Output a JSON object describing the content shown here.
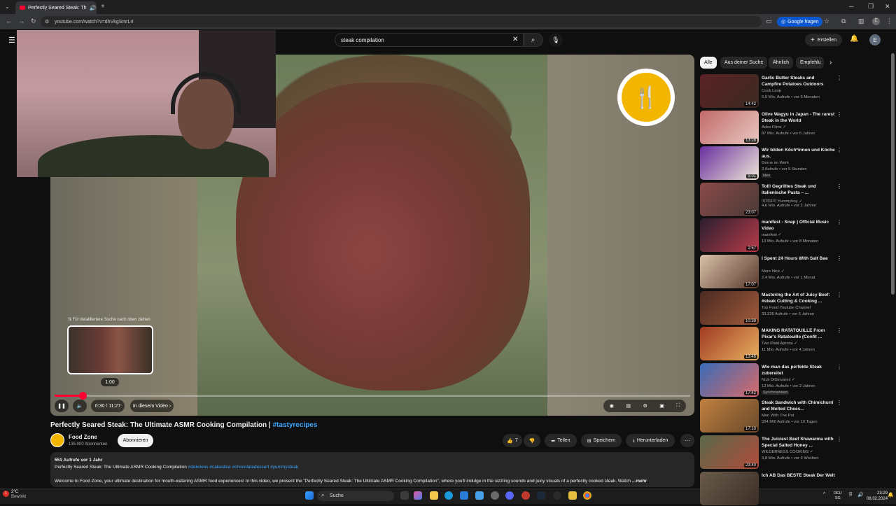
{
  "browser": {
    "tab_title": "Perfectly Seared Steak: Th",
    "url": "youtube.com/watch?v=dhVkgSmrLrI",
    "google_button": "Google fragen",
    "profile_initial": "E"
  },
  "header": {
    "search_value": "steak compilation",
    "create_label": "Erstellen",
    "avatar_initial": "E"
  },
  "player": {
    "hint_text": "⇅ Für detailliertere Suche nach oben ziehen",
    "preview_time": "1:00",
    "time": "0:30 / 11:27",
    "chapter_label": "In diesem Video",
    "progress_fraction": 0.044
  },
  "video": {
    "title": "Perfectly Seared Steak: The Ultimate ASMR Cooking Compilation | ",
    "title_tag": "#tastyrecipes",
    "channel_name": "Food Zone",
    "subscribers": "135.000 Abonnenten",
    "subscribe_label": "Abonnieren",
    "likes": "7",
    "share_label": "Teilen",
    "save_label": "Speichern",
    "download_label": "Herunterladen",
    "views_date": "551 Aufrufe  vor 1 Jahr",
    "desc_line1": "Perfectly Seared Steak: The Ultimate ASMR Cooking Compilation ",
    "desc_tags": "#delicious #cakeslice #chocolatedessert #yummysteak",
    "desc_line2": "Welcome to Food Zone, your ultimate destination for mouth-watering ASMR food experiences! In this video, we present the \"Perfectly Seared Steak: The Ultimate ASMR Cooking Compilation\", where you'll indulge in the sizzling sounds and juicy visuals of a perfectly cooked steak. Watch",
    "desc_more": "...mehr"
  },
  "sidebar": {
    "chips": [
      "Alle",
      "Aus deiner Suche",
      "Ähnlich",
      "Empfehlu"
    ],
    "recs": [
      {
        "title": "Garlic Butter Steaks and Campfire Potatoes Outdoors",
        "channel": "Cook Loop",
        "meta": "5,5 Mio. Aufrufe • vor 5 Monaten",
        "duration": "14:42",
        "colors": [
          "#5b2226",
          "#3c2a22"
        ]
      },
      {
        "title": "Olive Wagyu in Japan - The rarest Steak in the World",
        "channel": "Ades Films ✓",
        "meta": "87 Mio. Aufrufe • vor 6 Jahren",
        "duration": "13:28",
        "colors": [
          "#c26a6a",
          "#e8c8c0"
        ]
      },
      {
        "title": "Wir bilden Köch*innen und Köche aus.",
        "channel": "Gerne im Werk",
        "meta": "3 Aufrufe • vor 5 Stunden",
        "badge": "Neu",
        "duration": "9:01",
        "colors": [
          "#6a2fa0",
          "#efe6d8"
        ]
      },
      {
        "title": "Toll! Gegrilltes Steak und italienische Pasta – ...",
        "channel": "야미보이 Yummyboy ✓",
        "meta": "4,6 Mio. Aufrufe • vor 2 Jahren",
        "duration": "23:07",
        "colors": [
          "#8a4a4a",
          "#4a3a36"
        ]
      },
      {
        "title": "manifest - Snap | Official Music Video",
        "channel": "manifest ✓",
        "meta": "13 Mio. Aufrufe • vor 8 Monaten",
        "duration": "2:57",
        "colors": [
          "#2a1f2e",
          "#b83a4a"
        ]
      },
      {
        "title": "I Spent 24 Hours With Salt Bae",
        "channel": "More Nick ✓",
        "meta": "2,4 Mio. Aufrufe • vor 1 Monat",
        "duration": "17:07",
        "colors": [
          "#d8c0a8",
          "#5a3a2e"
        ]
      },
      {
        "title": "Mastering the Art of Juicy Beef: #steak  Cutting & Cooking ...",
        "channel": "Top Food Youtube Channel",
        "meta": "33.326 Aufrufe • vor 5 Jahren",
        "duration": "10:39",
        "colors": [
          "#4a2a22",
          "#a05a3a"
        ]
      },
      {
        "title": "MAKING RATATOUILLE From Pixar's Ratatouille (Confit ...",
        "channel": "Two Plaid Aprons ✓",
        "meta": "11 Mio. Aufrufe • vor 4 Jahren",
        "duration": "13:46",
        "colors": [
          "#a03a22",
          "#e8b060"
        ]
      },
      {
        "title": "Wie man das perfekte Steak zubereitet",
        "channel": "Nick DiGiovanni ✓",
        "meta": "13 Mio. Aufrufe • vor 2 Jahren",
        "badge": "Synchronisiert",
        "duration": "17:42",
        "colors": [
          "#3a6ab8",
          "#d86a6a"
        ]
      },
      {
        "title": "Steak Sandwich with Chimichurri and Melted Chees...",
        "channel": "Men With The Pot",
        "meta": "554.960 Aufrufe • vor 10 Tagen",
        "duration": "17:10",
        "colors": [
          "#c08040",
          "#6a4a2a"
        ]
      },
      {
        "title": "The Juiciest Beef Shawarma with Special Salted Honey ...",
        "channel": "WILDERNESS COOKING ✓",
        "meta": "3,8 Mio. Aufrufe • vor 3 Wochen",
        "duration": "23:40",
        "colors": [
          "#5a6a4a",
          "#b04a3a"
        ]
      },
      {
        "title": "Ich AB Das BESTE Steak Der Welt",
        "channel": "",
        "meta": "",
        "duration": "",
        "colors": [
          "#6a5a4a",
          "#3a2e26"
        ]
      }
    ]
  },
  "taskbar": {
    "temperature": "2°C",
    "weather": "Bewölkt",
    "search": "Suche",
    "lang1": "DEU",
    "lang2": "SG",
    "time": "23:29",
    "date": "08.02.2024"
  }
}
